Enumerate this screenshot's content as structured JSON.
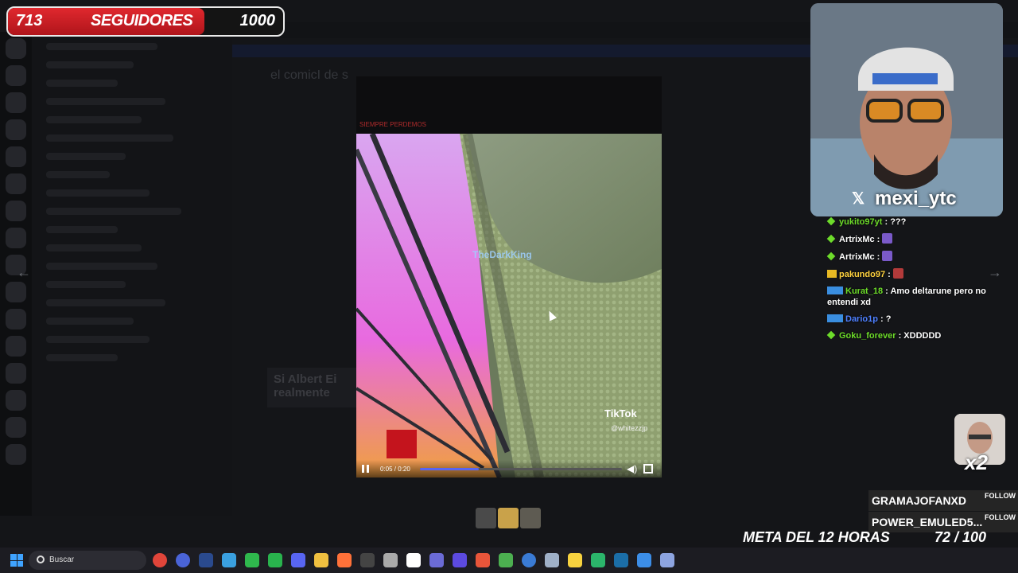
{
  "followers": {
    "count": "713",
    "label": "SEGUIDORES",
    "goal": "1000",
    "fraction": 0.713
  },
  "background": {
    "chat_title": "el comicI de s",
    "message_preview": "Si Albert Ei realmente",
    "nav_prev": "←",
    "nav_next": "→"
  },
  "video": {
    "tag": "SIEMPRE PERDEMOS",
    "watermark_name": "TheDarkKing",
    "tiktok_label": "TikTok",
    "tiktok_user": "@whitezzjp",
    "time": "0:05 / 0:20",
    "progress": 0.29
  },
  "webcam": {
    "handle": "mexi_ytc",
    "platform_icon": "x-icon"
  },
  "chat": [
    {
      "user": "yukito97yt",
      "text": " : ???",
      "badge": "diamond",
      "color": "#6ddc2a"
    },
    {
      "user": "ArtrixMc",
      "text": " : ",
      "badge": "diamond",
      "color": "#ffffff",
      "emote": "#7a5ac9"
    },
    {
      "user": "ArtrixMc",
      "text": " : ",
      "badge": "diamond",
      "color": "#ffffff",
      "emote": "#7a5ac9"
    },
    {
      "user": "pakundo97",
      "text": " : ",
      "badge": "crown",
      "color": "#ffd23f",
      "emote": "#b33a3a"
    },
    {
      "user": "Kurat_18",
      "text": " : Amo deltarune pero no entendi xd",
      "badge": "prime",
      "color": "#6ddc2a"
    },
    {
      "user": "Dario1p",
      "text": " : ?",
      "badge": "prime",
      "color": "#4e80ff"
    },
    {
      "user": "Goku_forever",
      "text": " : XDDDDD",
      "badge": "diamond",
      "color": "#6ddc2a"
    }
  ],
  "multiplier": "x2",
  "follows": [
    {
      "name": "GRAMAJOFANXD",
      "tag": "FOLLOW"
    },
    {
      "name": "POWER_EMULED5...",
      "tag": "FOLLOW"
    }
  ],
  "goal": {
    "label": "META DEL 12 HORAS",
    "count": "72 / 100",
    "fraction": 0.72
  },
  "taskbar": {
    "search_placeholder": "Buscar",
    "icons": [
      "chrome-icon",
      "vivaldi-icon",
      "photoshop-icon",
      "telegram-icon",
      "line-icon",
      "whatsapp-icon",
      "discord-icon",
      "folder-icon",
      "firefox-icon",
      "epic-icon",
      "roblox-icon",
      "capcut-icon",
      "obs-icon",
      "shield-icon",
      "brave-icon",
      "maps-icon",
      "image-icon",
      "edit-icon",
      "sticky-notes-icon",
      "chat-icon",
      "steam-icon",
      "vscode-icon",
      "sync-icon"
    ],
    "icon_colors": [
      "#e0453a",
      "#4a64d8",
      "#2a4a8e",
      "#3aa0e0",
      "#2fb84d",
      "#29b34d",
      "#5865f2",
      "#f0c040",
      "#ff7139",
      "#444444",
      "#aaaaaa",
      "#ffffff",
      "#6b6bd6",
      "#5c4ae0",
      "#e8553a",
      "#4caf50",
      "#3a7bd5",
      "#9fb0c8",
      "#f7d23f",
      "#2bb56b",
      "#1b6ea8",
      "#3c8ee8",
      "#8da4e0"
    ]
  }
}
